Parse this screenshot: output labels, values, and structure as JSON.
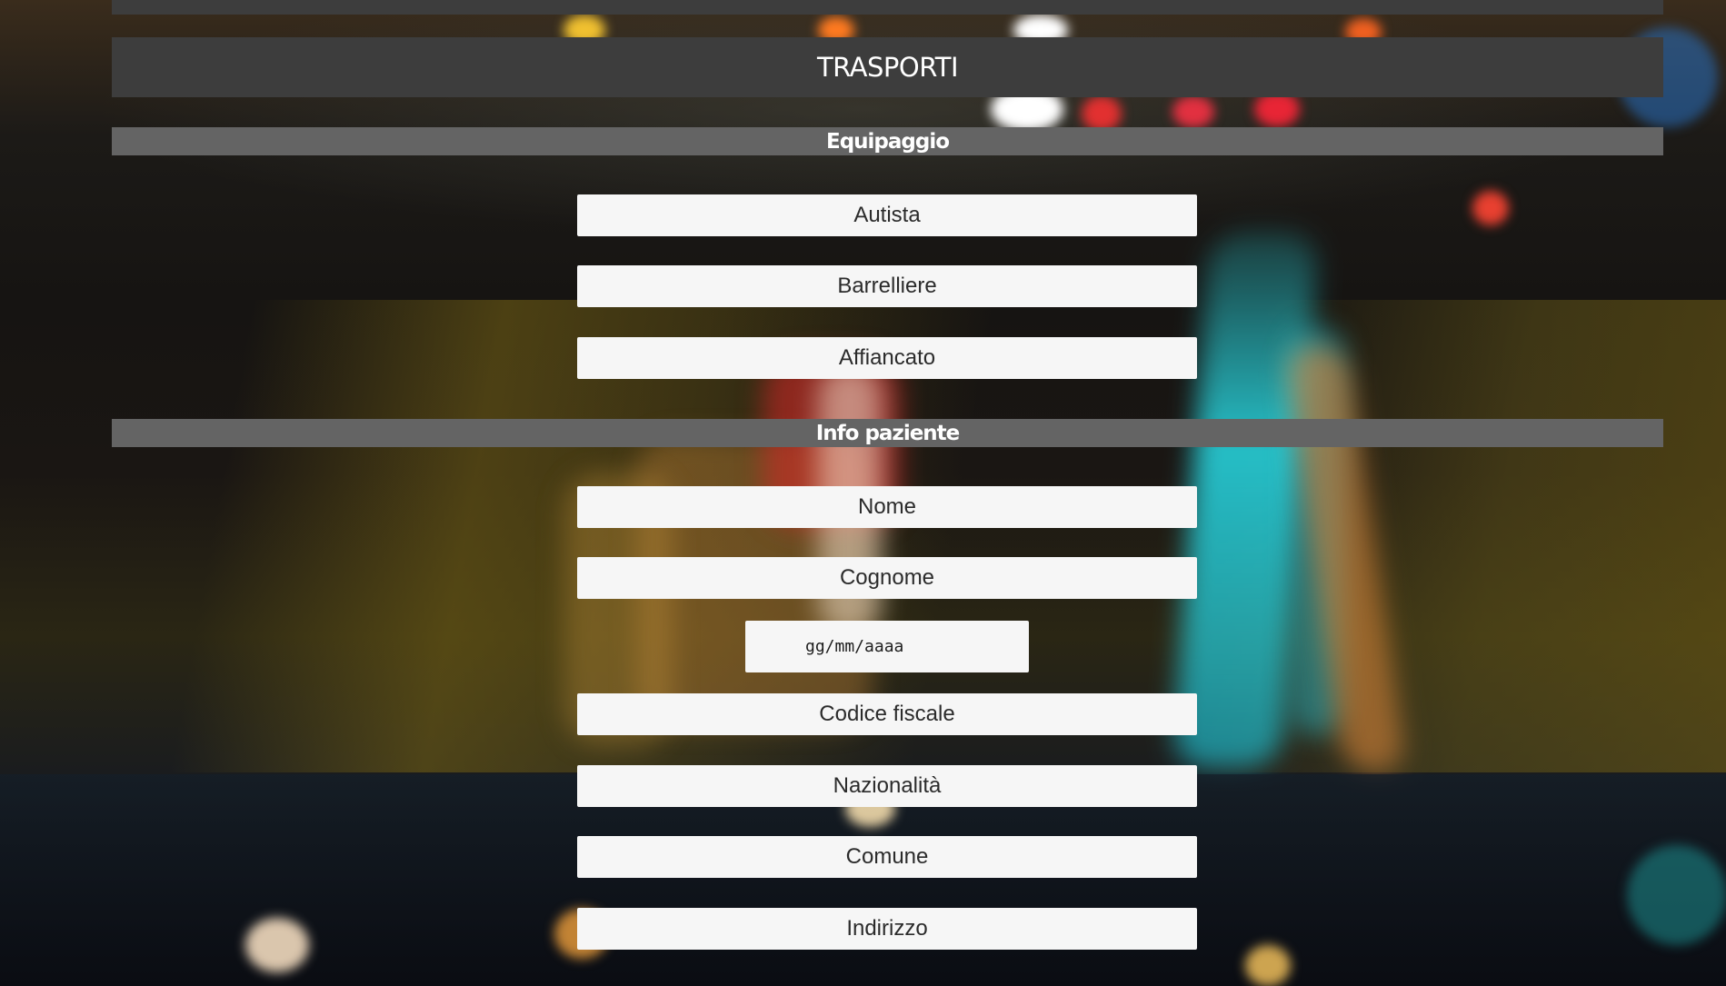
{
  "header": {
    "title": "TRASPORTI"
  },
  "sections": {
    "crew": {
      "label": "Equipaggio",
      "fields": {
        "driver": "Autista",
        "stretcher_bearer": "Barrelliere",
        "trainee": "Affiancato"
      }
    },
    "patient": {
      "label": "Info paziente",
      "fields": {
        "first_name": "Nome",
        "last_name": "Cognome",
        "birth_date_placeholder": "gg/mm/aaaa",
        "tax_code": "Codice fiscale",
        "nationality": "Nazionalità",
        "municipality": "Comune",
        "address": "Indirizzo"
      }
    }
  },
  "colors": {
    "header_bg": "#3d3d3d",
    "section_bg": "#646464",
    "field_bg": "#f6f6f6",
    "text_light": "#ffffff",
    "text_dark": "#2b2b2b"
  }
}
